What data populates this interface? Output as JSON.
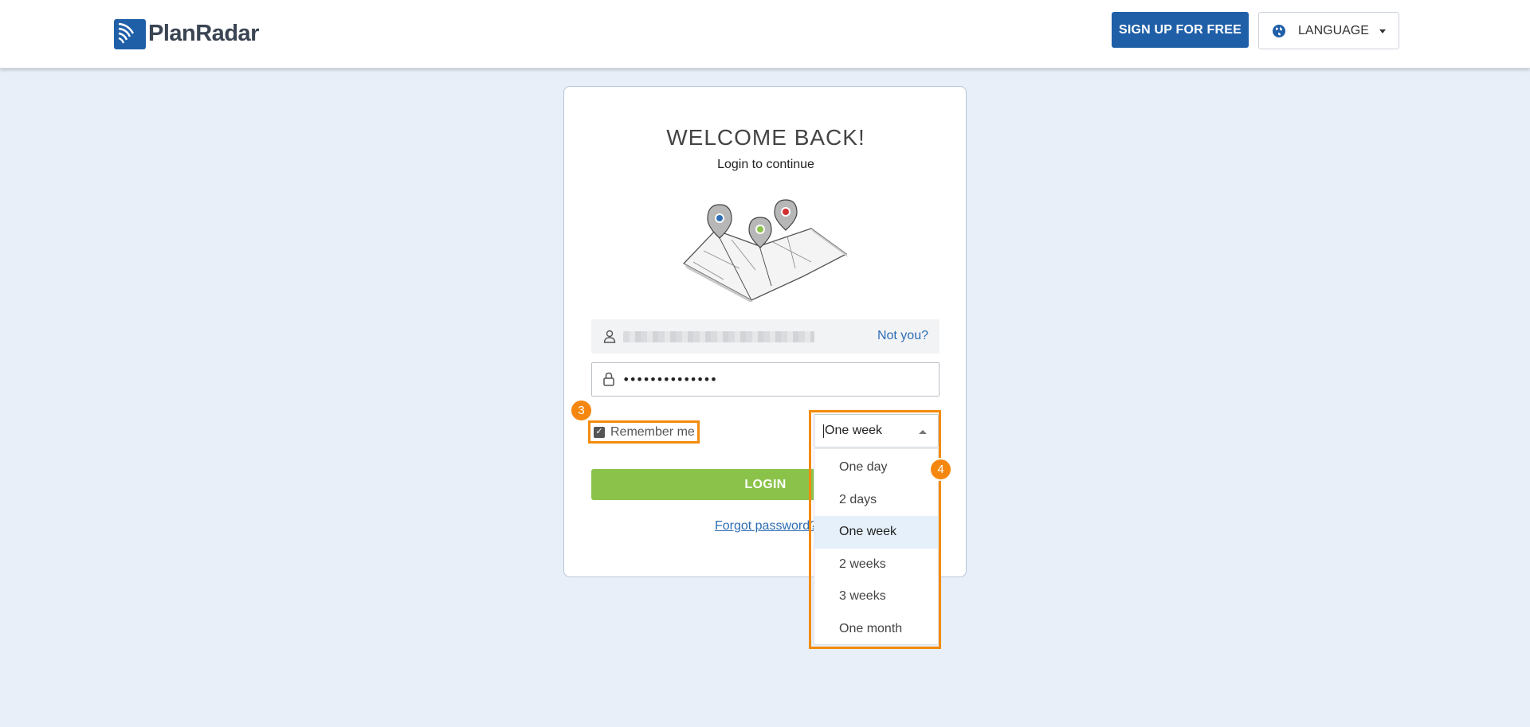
{
  "header": {
    "brand": "PlanRadar",
    "signup_label": "SIGN UP FOR FREE",
    "language_label": "LANGUAGE"
  },
  "login": {
    "title": "WELCOME BACK!",
    "subtitle": "Login to continue",
    "not_you": "Not you?",
    "password_value": "••••••••••••••",
    "remember_label": "Remember me",
    "remember_checked": true,
    "login_label": "LOGIN",
    "forgot_label": "Forgot password?"
  },
  "duration": {
    "selected": "One week",
    "options": [
      "One day",
      "2 days",
      "One week",
      "2 weeks",
      "3 weeks",
      "One month"
    ]
  },
  "annotations": {
    "badge_remember": "3",
    "badge_duration": "4",
    "highlight_color": "#f28b0f"
  },
  "colors": {
    "brand_blue": "#1f5fa8",
    "login_green": "#8bc34a",
    "link_blue": "#2d6db4",
    "page_bg": "#e8eff8"
  }
}
